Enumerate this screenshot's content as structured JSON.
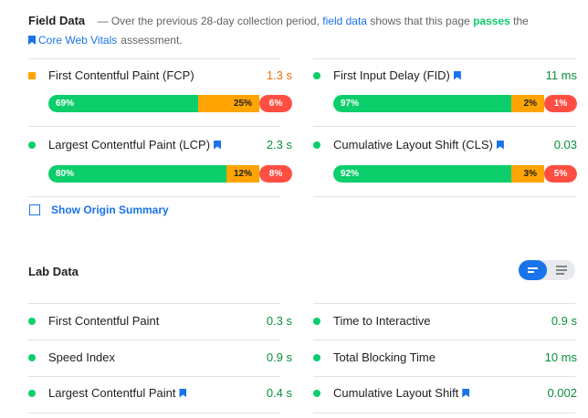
{
  "field": {
    "title": "Field Data",
    "description_dash": "—",
    "description_pre": "Over the previous 28-day collection period,",
    "description_link": "field data",
    "description_mid": "shows that this page",
    "description_status": "passes",
    "description_post": "the",
    "cwv_link": "Core Web Vitals",
    "cwv_post": "assessment.",
    "metrics": [
      {
        "label": "First Contentful Paint (FCP)",
        "value": "1.3 s",
        "status": "average",
        "dist": [
          "69%",
          "25%",
          "6%"
        ],
        "dist_values": [
          69,
          25,
          6
        ]
      },
      {
        "label": "First Input Delay (FID)",
        "value": "11 ms",
        "status": "fast",
        "dist": [
          "97%",
          "2%",
          "1%"
        ],
        "dist_values": [
          97,
          2,
          1
        ]
      },
      {
        "label": "Largest Contentful Paint (LCP)",
        "value": "2.3 s",
        "status": "fast",
        "dist": [
          "80%",
          "12%",
          "8%"
        ],
        "dist_values": [
          80,
          12,
          8
        ]
      },
      {
        "label": "Cumulative Layout Shift (CLS)",
        "value": "0.03",
        "status": "fast",
        "dist": [
          "92%",
          "3%",
          "5%"
        ],
        "dist_values": [
          92,
          3,
          5
        ]
      }
    ],
    "origin_summary_label": "Show Origin Summary"
  },
  "lab": {
    "title": "Lab Data",
    "metrics": [
      {
        "label": "First Contentful Paint",
        "value": "0.3 s"
      },
      {
        "label": "Time to Interactive",
        "value": "0.9 s"
      },
      {
        "label": "Speed Index",
        "value": "0.9 s"
      },
      {
        "label": "Total Blocking Time",
        "value": "10 ms"
      },
      {
        "label": "Largest Contentful Paint",
        "value": "0.4 s"
      },
      {
        "label": "Cumulative Layout Shift",
        "value": "0.002"
      }
    ]
  },
  "colors": {
    "pass": "#0cce6b",
    "average": "#ffa400",
    "fail": "#ff4e42",
    "accent": "#1a73e8"
  },
  "icons": [
    "square-average-icon",
    "circle-pass-icon",
    "bookmark-icon",
    "checkbox-icon",
    "list-view-icon",
    "compact-view-icon"
  ]
}
